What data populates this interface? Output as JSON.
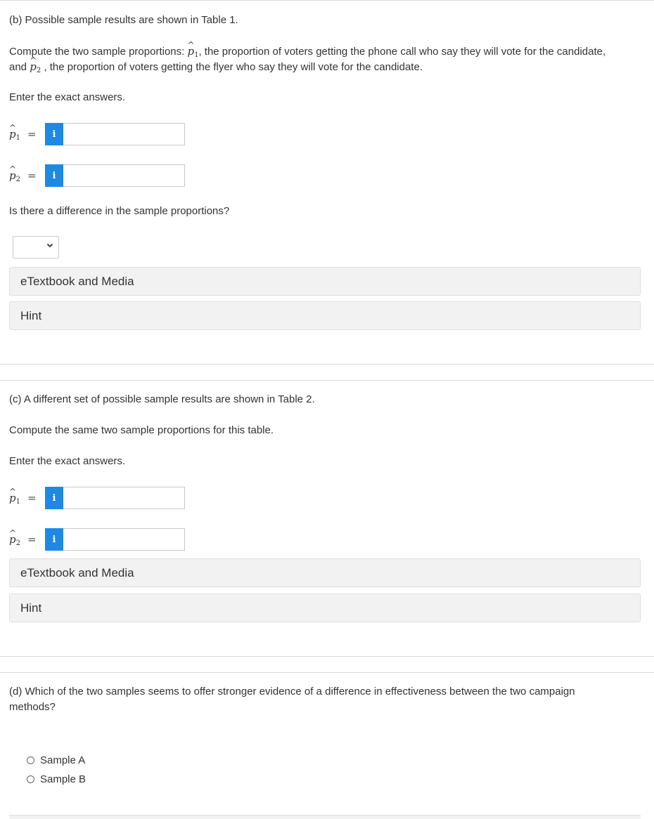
{
  "part_b": {
    "heading": "(b) Possible sample results are shown in Table 1.",
    "compute_prefix": "Compute the two sample proportions: ",
    "compute_mid": ", the proportion of voters getting the phone call who say they will vote for the candidate,",
    "compute_and": "and ",
    "compute_end": " , the proportion of voters getting the flyer who say they will vote for the candidate.",
    "exact": "Enter the exact answers.",
    "p1_value": "",
    "p2_value": "",
    "difference_question": "Is there a difference in the sample proportions?",
    "difference_selected": "",
    "etextbook": "eTextbook and Media",
    "hint": "Hint"
  },
  "part_c": {
    "heading": "(c) A different set of possible sample results are shown in Table 2.",
    "compute": "Compute the same two sample proportions for this table.",
    "exact": "Enter the exact answers.",
    "p1_value": "",
    "p2_value": "",
    "etextbook": "eTextbook and Media",
    "hint": "Hint"
  },
  "part_d": {
    "question_line1": "(d) Which of the two samples seems to offer stronger evidence of a difference in effectiveness between the two campaign",
    "question_line2": "methods?",
    "options": [
      "Sample A",
      "Sample B"
    ]
  },
  "symbols": {
    "p_letter": "p",
    "hat": "^",
    "sub1": "1",
    "sub2": "2",
    "equals": "=",
    "info": "i",
    "chevron": "⌄"
  },
  "colors": {
    "info_button": "#1e88e5",
    "panel_bg": "#f2f2f2",
    "text": "#333333"
  }
}
